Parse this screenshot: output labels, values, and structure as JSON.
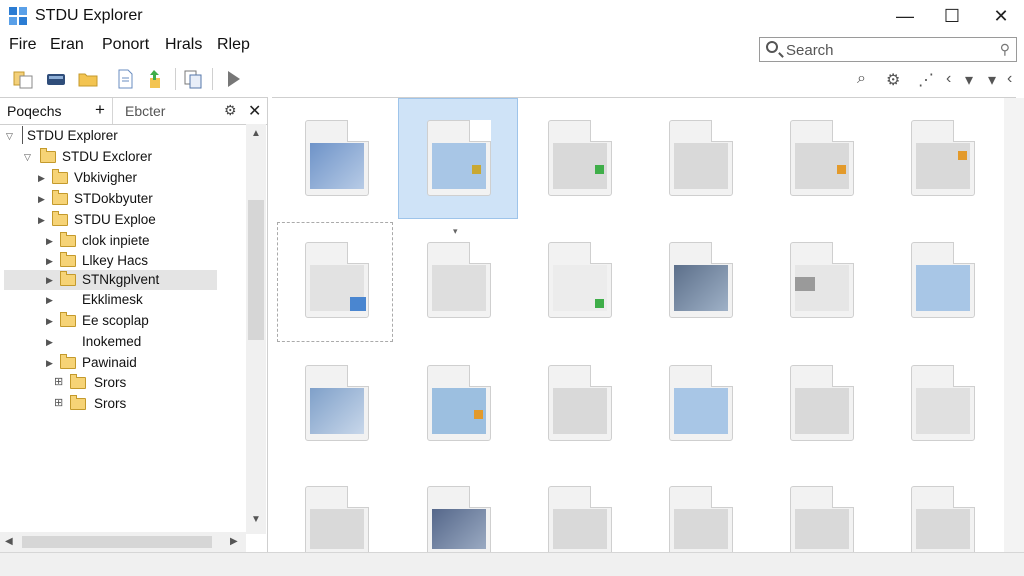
{
  "window": {
    "title": "STDU Explorer",
    "minimize": "—",
    "maximize": "☐",
    "close": "✕"
  },
  "menu": [
    "Fire",
    "Eran",
    "Ponort",
    "Hrals",
    "Rlep"
  ],
  "search": {
    "placeholder": "Search"
  },
  "toolbar_right": {
    "zoom": "⌕",
    "settings": "⚙",
    "step": "⋰",
    "nav1": "‹",
    "nav2": "▾",
    "nav3": "‹",
    "nav4": "▾"
  },
  "panel": {
    "tab_projects": "Poqechs",
    "tab_add": "+",
    "tab_explorer": "Ebcter",
    "tab_settings": "⚙",
    "tab_close": "✕"
  },
  "tree": [
    {
      "label": "STDU Explorer",
      "expanded": true
    },
    {
      "label": "STDU Exclorer",
      "expanded": true
    },
    {
      "label": "Vbkivigher",
      "expanded": false
    },
    {
      "label": "STDokbyuter",
      "expanded": false
    },
    {
      "label": "STDU Exploe",
      "expanded": false
    },
    {
      "label": "clok inpiete",
      "expanded": false
    },
    {
      "label": "Llkey Hacs",
      "expanded": false
    },
    {
      "label": "STNkgplvent",
      "expanded": false
    },
    {
      "label": "Ekklimesk",
      "expanded": false
    },
    {
      "label": "Ee scoplap",
      "expanded": false
    },
    {
      "label": "Inokemed",
      "expanded": false
    },
    {
      "label": "Pawinaid",
      "expanded": false
    },
    {
      "label": "Srors",
      "expanded": false
    },
    {
      "label": "Srors",
      "expanded": false
    }
  ],
  "colors": {
    "accent": "#2b7cd3",
    "selection": "#cfe3f7",
    "folder": "#f6d376",
    "green": "#3fae49",
    "orange": "#e39a2b",
    "blue_preview": "#9cbfe0"
  }
}
